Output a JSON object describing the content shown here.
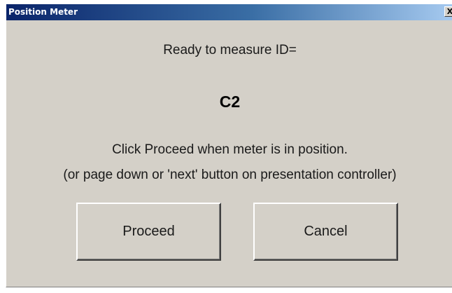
{
  "window": {
    "title": "Position Meter",
    "close_glyph": "X"
  },
  "dialog": {
    "prompt": "Ready to measure ID=",
    "measure_id": "C2",
    "instruction": "Click Proceed when meter is in position.",
    "hint": "(or page down or 'next' button on presentation controller)"
  },
  "buttons": {
    "proceed_label": "Proceed",
    "cancel_label": "Cancel"
  },
  "colors": {
    "title_bar": "#0a246a",
    "dialog_face": "#d4d0c8"
  }
}
